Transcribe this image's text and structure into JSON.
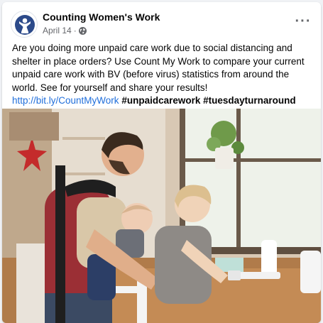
{
  "post": {
    "author": "Counting Women's Work",
    "date": "April 14",
    "separator": "·",
    "privacy_icon": "globe-icon",
    "more_icon": "more-options-icon",
    "more_label": "···",
    "body_text": "Are you doing more unpaid care work due to social distancing and shelter in place orders? Use Count My Work to compare your current unpaid care work with BV (before virus) statistics from around the world. See for yourself and share your results!",
    "link": "http://bit.ly/CountMyWork",
    "hashtags": [
      "#unpaidcarework",
      "#tuesdayturnaround"
    ]
  },
  "photo": {
    "subject": "man carrying a baby in a front carrier while a toddler stands at a kitchen counter"
  },
  "colors": {
    "link": "#216fdb",
    "logo_blue": "#2c4a8a",
    "muted": "#65676b"
  }
}
